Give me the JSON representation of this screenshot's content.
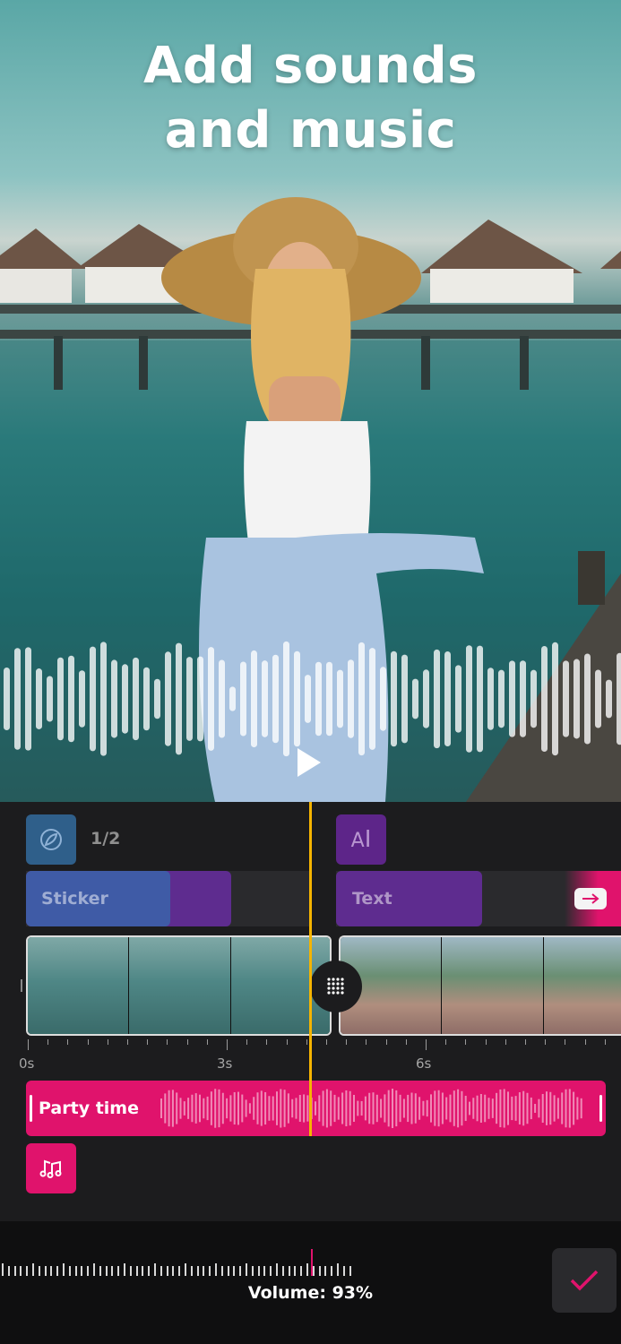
{
  "preview": {
    "headline": "Add sounds and music",
    "play_icon": "play-icon"
  },
  "tracks": {
    "effects_icon": "effect-icon",
    "effects_count": "1/2",
    "text_icon": "text-cursor-icon",
    "sticker_label": "Sticker",
    "text_label": "Text",
    "next_icon": "arrow-right-icon",
    "split_icon": "grid-dots-icon"
  },
  "ruler": {
    "labels": [
      "0s",
      "3s",
      "6s"
    ]
  },
  "audio": {
    "label": "Party time",
    "music_icon": "music-note-icon"
  },
  "footer": {
    "volume_label": "Volume: 93%",
    "volume_value": 93,
    "confirm_icon": "checkmark-icon"
  },
  "colors": {
    "accent": "#e0136c",
    "playhead": "#f5b400",
    "sticker": "#3f5ba6",
    "text_track": "#6a2a95"
  }
}
